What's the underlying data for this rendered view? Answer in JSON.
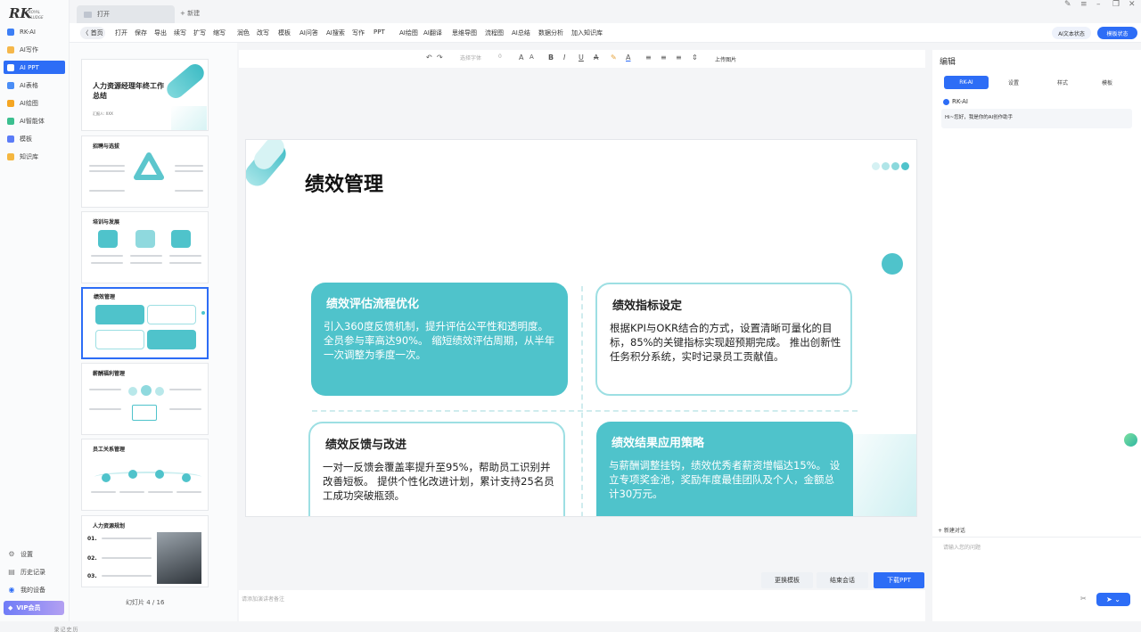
{
  "brand": {
    "logo_text": "RK",
    "logo_sub": "ROYAL KLUDGE",
    "accent": "#2d6df6",
    "teal": "#4fc3cb"
  },
  "sidebar": {
    "items": [
      {
        "label": "RK-AI",
        "icon": "rk-ai-icon",
        "color": "#3d7ff5"
      },
      {
        "label": "AI写作",
        "icon": "write-icon",
        "color": "#f5b74a"
      },
      {
        "label": "AI PPT",
        "icon": "ppt-icon",
        "color": "#35b37e",
        "active": true
      },
      {
        "label": "AI表格",
        "icon": "table-icon",
        "color": "#4a8df6"
      },
      {
        "label": "AI绘图",
        "icon": "draw-icon",
        "color": "#f5a623"
      },
      {
        "label": "AI智能体",
        "icon": "agent-icon",
        "color": "#3bbf8f"
      },
      {
        "label": "模板",
        "icon": "template-icon",
        "color": "#5b7cf7"
      },
      {
        "label": "知识库",
        "icon": "knowledge-icon",
        "color": "#f5b740"
      }
    ],
    "bottom": [
      {
        "label": "设置",
        "icon": "gear-icon"
      },
      {
        "label": "历史记录",
        "icon": "history-icon"
      },
      {
        "label": "我的设备",
        "icon": "device-icon"
      }
    ],
    "vip": "VIP会员"
  },
  "tabs": {
    "doc_tab": "打开",
    "new_tab": "+ 新建"
  },
  "toolbar": {
    "home": "〈 首页",
    "items": [
      "打开",
      "保存",
      "导出",
      "续写",
      "扩写",
      "缩写",
      "润色",
      "改写",
      "模板",
      "AI问答",
      "AI搜索",
      "写作",
      "PPT",
      "AI绘图",
      "AI翻译",
      "思维导图",
      "流程图",
      "AI总结",
      "数据分析",
      "加入知识库"
    ],
    "status_btn": "AI文本状态",
    "mode_btn": "模板状态"
  },
  "format_bar": {
    "font_placeholder": "选择字体",
    "font_size": "0",
    "upload": "上传图片"
  },
  "thumbnails": {
    "slides": [
      {
        "title": "人力资源经理年终工作总结",
        "sub": "汇报人: XXX"
      },
      {
        "title": "招聘与选拔"
      },
      {
        "title": "培训与发展"
      },
      {
        "title": "绩效管理"
      },
      {
        "title": "薪酬福利管理"
      },
      {
        "title": "员工关系管理"
      },
      {
        "title": "人力资源规划",
        "nums": [
          "01.",
          "02.",
          "03."
        ]
      }
    ],
    "history_label": "历史记录",
    "counter": "幻灯片 4 / 16"
  },
  "slide": {
    "title": "绩效管理",
    "cards": [
      {
        "heading": "绩效评估流程优化",
        "body": "引入360度反馈机制，提升评估公平性和透明度。全员参与率高达90%。 缩短绩效评估周期，从半年一次调整为季度一次。"
      },
      {
        "heading": "绩效指标设定",
        "body": "根据KPI与OKR结合的方式，设置清晰可量化的目标，85%的关键指标实现超预期完成。 推出创新性任务积分系统，实时记录员工贡献值。"
      },
      {
        "heading": "绩效反馈与改进",
        "body": "一对一反馈会覆盖率提升至95%，帮助员工识别并改善短板。 提供个性化改进计划，累计支持25名员工成功突破瓶颈。"
      },
      {
        "heading": "绩效结果应用策略",
        "body": "与薪酬调整挂钩，绩效优秀者薪资增幅达15%。 设立专项奖金池，奖励年度最佳团队及个人，金额总计30万元。"
      }
    ]
  },
  "bottom_actions": {
    "change_template": "更换模板",
    "end_session": "结束会话",
    "download": "下载PPT"
  },
  "notes": {
    "placeholder": "请添加演讲者备注"
  },
  "right_panel": {
    "title": "编辑",
    "tabs": [
      "RK-AI",
      "设置",
      "样式",
      "模板"
    ],
    "assistant_name": "RK-AI",
    "greeting": "Hi~您好，我是你的AI创作助手",
    "new_chat": "+ 新建对话",
    "input_placeholder": "请输入您的问题"
  }
}
